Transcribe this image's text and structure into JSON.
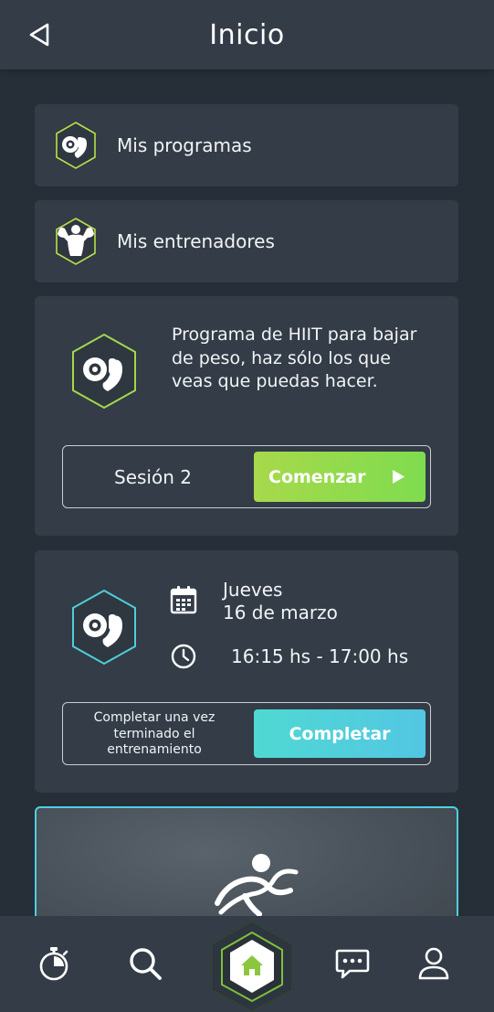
{
  "header": {
    "title": "Inicio"
  },
  "menu": [
    {
      "label": "Mis programas",
      "icon": "program-hex-icon"
    },
    {
      "label": "Mis entrenadores",
      "icon": "trainer-hex-icon"
    }
  ],
  "program": {
    "description": "Programa de HIIT para bajar de peso, haz sólo los que veas que puedas hacer.",
    "session_label": "Sesión 2",
    "start_label": "Comenzar"
  },
  "schedule": {
    "day": "Jueves",
    "date": "16 de marzo",
    "time": "16:15 hs - 17:00 hs",
    "complete_note": "Completar una vez terminado el entrenamiento",
    "complete_label": "Completar"
  },
  "nav": {
    "items": [
      "timer-icon",
      "search-icon",
      "home-icon",
      "chat-icon",
      "profile-icon"
    ],
    "active": "home-icon"
  },
  "colors": {
    "background": "#262e38",
    "card": "#333c47",
    "green_accent": "#9bd84b",
    "cyan_accent": "#4fd3dc"
  }
}
